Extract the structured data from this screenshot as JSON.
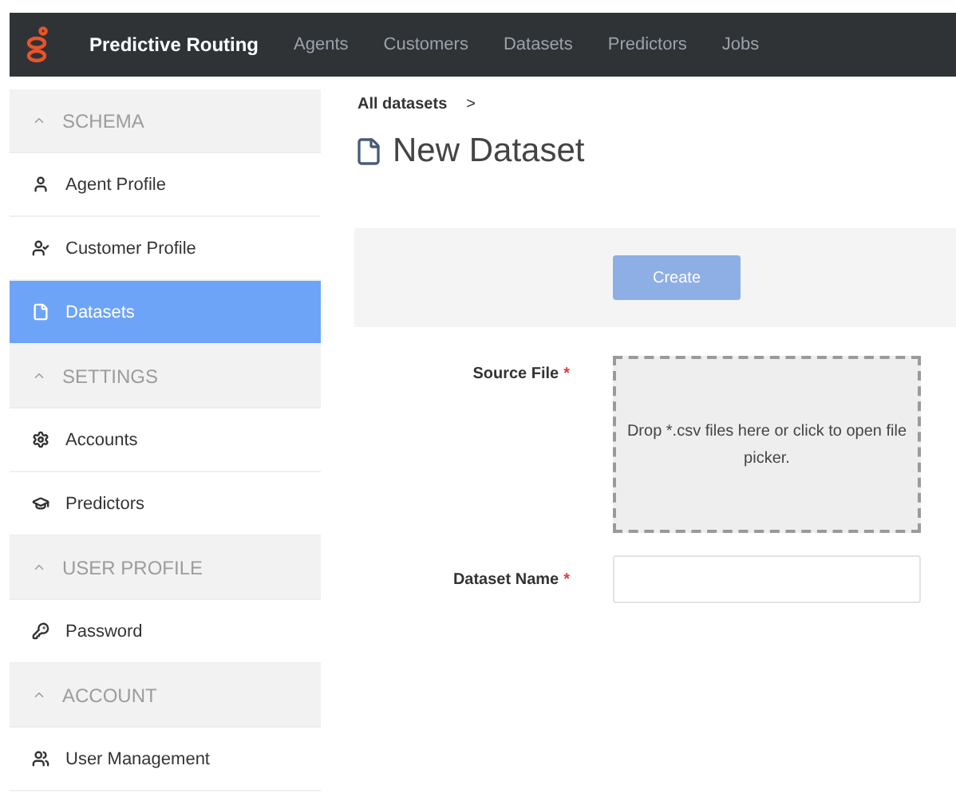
{
  "header": {
    "brand": "Predictive Routing",
    "nav": [
      {
        "label": "Agents",
        "selected": false
      },
      {
        "label": "Customers",
        "selected": false
      },
      {
        "label": "Datasets",
        "selected": false
      },
      {
        "label": "Predictors",
        "selected": false
      },
      {
        "label": "Jobs",
        "selected": false
      }
    ]
  },
  "sidebar": {
    "sections": [
      {
        "title": "SCHEMA",
        "expanded": true,
        "items": [
          {
            "label": "Agent Profile",
            "selected": false
          },
          {
            "label": "Customer Profile",
            "selected": false
          },
          {
            "label": "Datasets",
            "selected": true
          }
        ]
      },
      {
        "title": "SETTINGS",
        "expanded": true,
        "items": [
          {
            "label": "Accounts",
            "selected": false
          },
          {
            "label": "Predictors",
            "selected": false
          }
        ]
      },
      {
        "title": "USER PROFILE",
        "expanded": true,
        "items": [
          {
            "label": "Password",
            "selected": false
          }
        ]
      },
      {
        "title": "ACCOUNT",
        "expanded": true,
        "items": [
          {
            "label": "User Management",
            "selected": false
          }
        ]
      }
    ]
  },
  "breadcrumb": {
    "link": "All datasets",
    "separator": ">"
  },
  "page_title": "New Dataset",
  "create_button": {
    "label": "Create",
    "disabled": true
  },
  "fields": [
    {
      "kind": "dropzone",
      "label": "Source File",
      "required_mark": "*",
      "hint": "Drop *.csv files here or click to open file picker."
    },
    {
      "kind": "text",
      "label": "Dataset Name",
      "required_mark": "*"
    }
  ]
}
